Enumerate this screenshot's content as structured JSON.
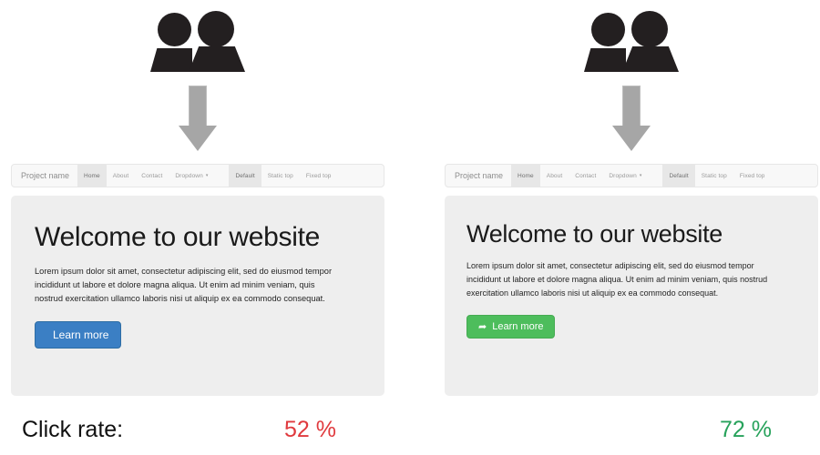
{
  "variants": [
    {
      "id": "variant-a",
      "icon_name": "users-icon",
      "arrow_name": "down-arrow-icon",
      "navbar": {
        "brand": "Project name",
        "links": [
          {
            "label": "Home",
            "active": true
          },
          {
            "label": "About",
            "active": false
          },
          {
            "label": "Contact",
            "active": false
          },
          {
            "label": "Dropdown",
            "caret": "▾",
            "active": false
          }
        ],
        "right_links": [
          {
            "label": "Default",
            "active": true
          },
          {
            "label": "Static top",
            "active": false
          },
          {
            "label": "Fixed top",
            "active": false
          }
        ]
      },
      "hero": {
        "title": "Welcome to our website",
        "text": "Lorem ipsum dolor sit amet, consectetur adipiscing elit, sed do eiusmod tempor incididunt ut labore et dolore magna aliqua. Ut enim ad minim veniam, quis nostrud exercitation ullamco laboris nisi ut aliquip ex ea commodo consequat.",
        "cta_label": "Learn more",
        "cta_icon": "",
        "cta_style": "primary",
        "cta_color": "#3b7fc4"
      },
      "result": {
        "label": "Click rate:",
        "value": "52 %",
        "color": "#e03a3e"
      }
    },
    {
      "id": "variant-b",
      "icon_name": "users-icon",
      "arrow_name": "down-arrow-icon",
      "navbar": {
        "brand": "Project name",
        "links": [
          {
            "label": "Home",
            "active": true
          },
          {
            "label": "About",
            "active": false
          },
          {
            "label": "Contact",
            "active": false
          },
          {
            "label": "Dropdown",
            "caret": "▾",
            "active": false
          }
        ],
        "right_links": [
          {
            "label": "Default",
            "active": true
          },
          {
            "label": "Static top",
            "active": false
          },
          {
            "label": "Fixed top",
            "active": false
          }
        ]
      },
      "hero": {
        "title": "Welcome to our website",
        "text": "Lorem ipsum dolor sit amet, consectetur adipiscing elit, sed do eiusmod tempor incididunt ut labore et dolore magna aliqua. Ut enim ad minim veniam, quis nostrud exercitation ullamco laboris nisi ut aliquip ex ea commodo consequat.",
        "cta_label": "Learn more",
        "cta_icon": "➦",
        "cta_style": "success",
        "cta_color": "#4dbd5c"
      },
      "result": {
        "label": "",
        "value": "72 %",
        "color": "#27a25b"
      }
    }
  ]
}
